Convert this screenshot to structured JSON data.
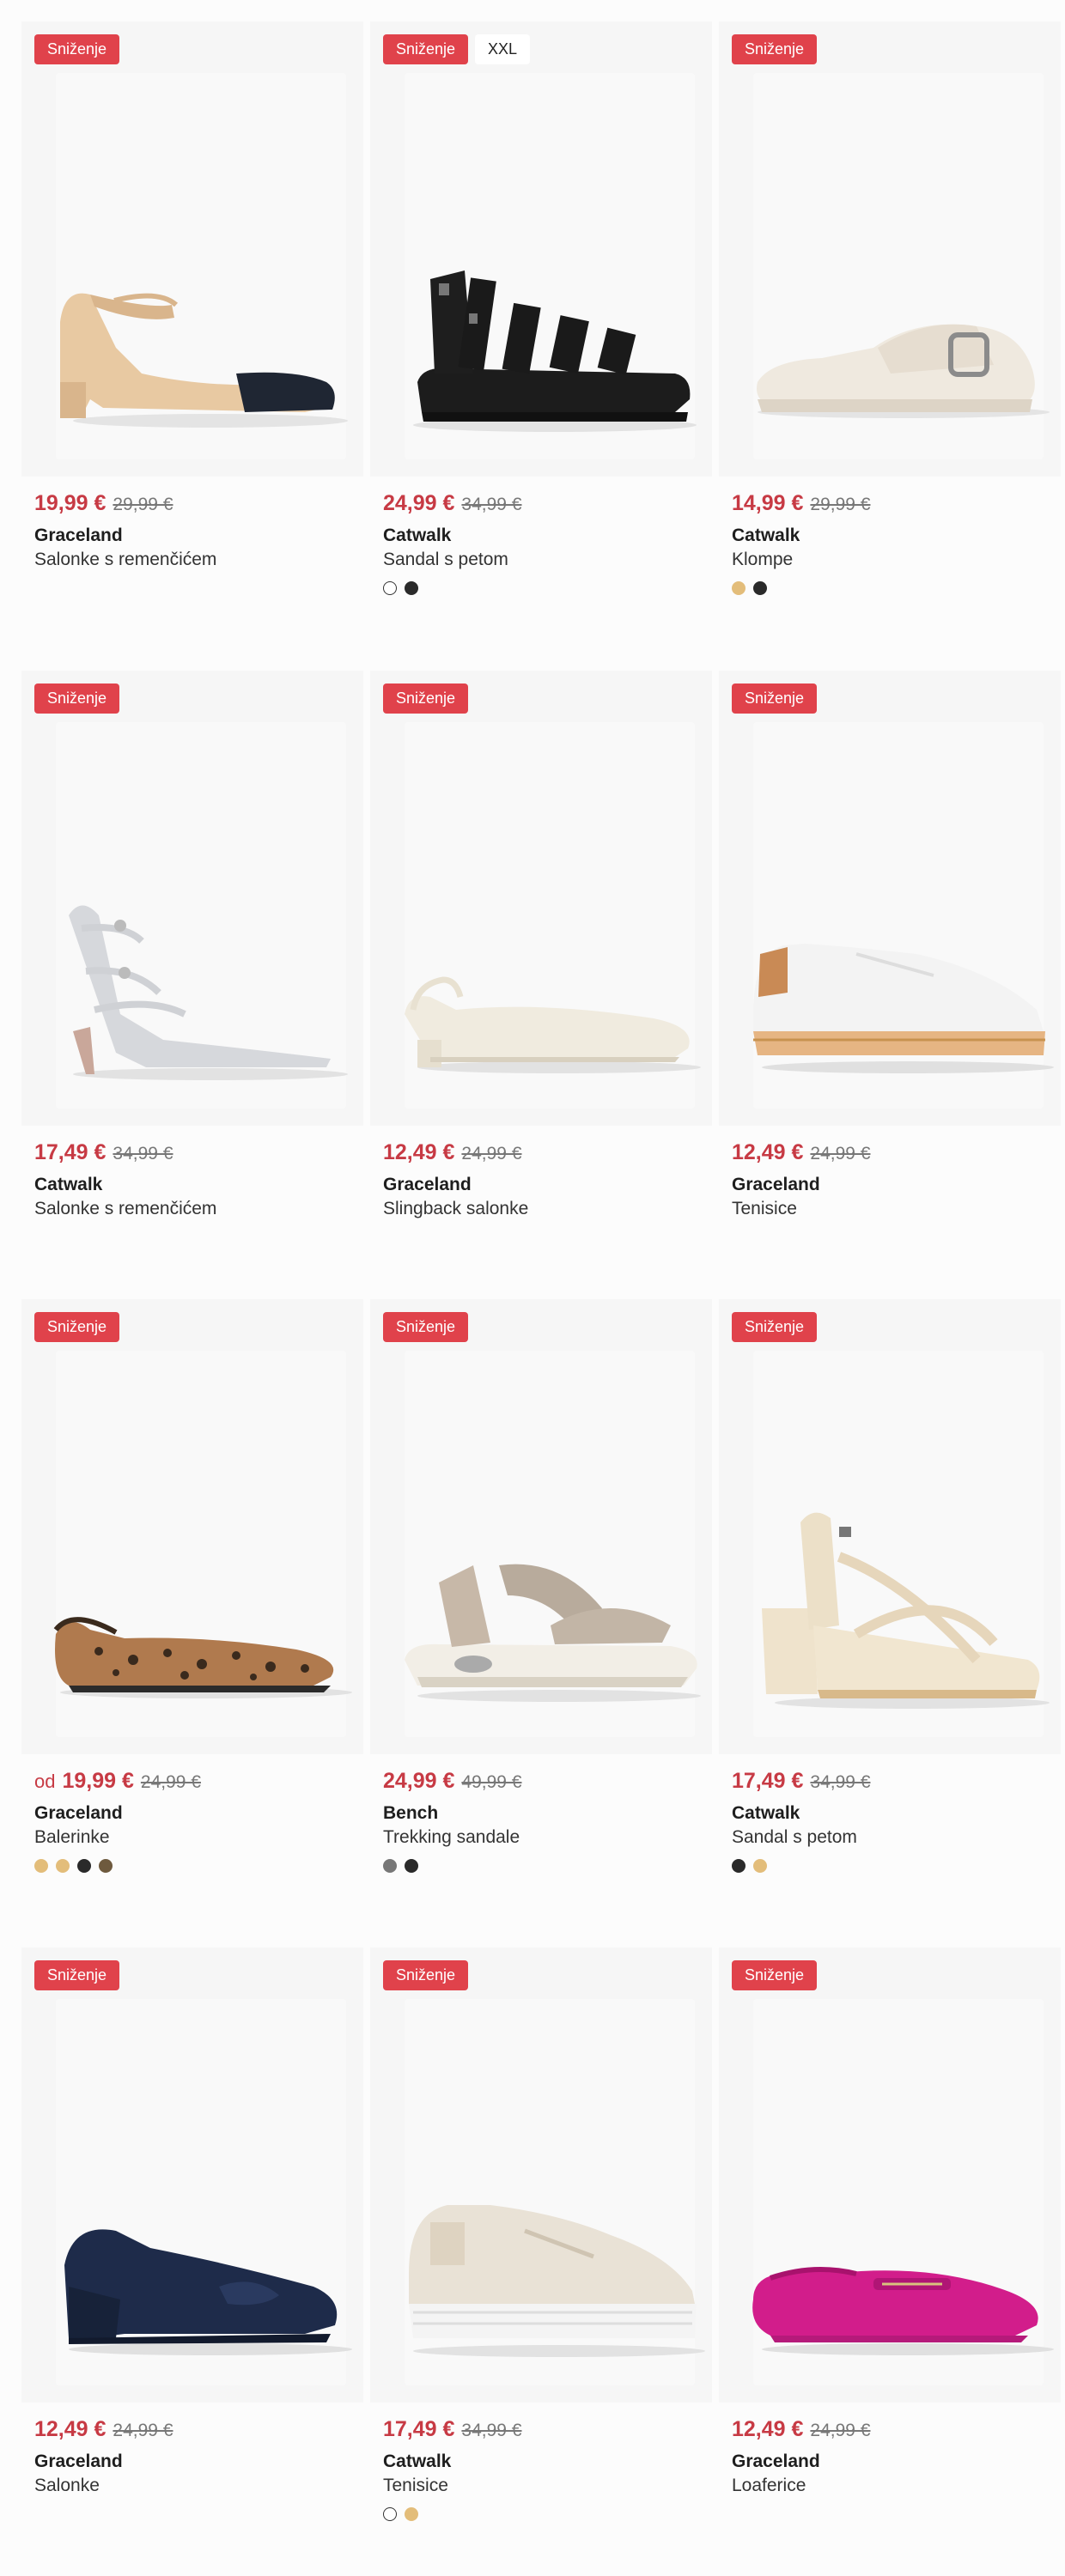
{
  "products": [
    {
      "badge": "Sniženje",
      "size_badge": "",
      "prefix": "",
      "price": "19,99 €",
      "old_price": "29,99 €",
      "brand": "Graceland",
      "name": "Salonke s remenčićem",
      "colors": [],
      "shoe": "beige-pump-strap"
    },
    {
      "badge": "Sniženje",
      "size_badge": "XXL",
      "prefix": "",
      "price": "24,99 €",
      "old_price": "34,99 €",
      "brand": "Catwalk",
      "name": "Sandal s petom",
      "colors": [
        "#ffffff",
        "#2a2a2a"
      ],
      "shoe": "black-gladiator"
    },
    {
      "badge": "Sniženje",
      "size_badge": "",
      "prefix": "",
      "price": "14,99 €",
      "old_price": "29,99 €",
      "brand": "Catwalk",
      "name": "Klompe",
      "colors": [
        "#e3bd7a",
        "#2a2a2a"
      ],
      "shoe": "cream-clog"
    },
    {
      "badge": "Sniženje",
      "size_badge": "",
      "prefix": "",
      "price": "17,49 €",
      "old_price": "34,99 €",
      "brand": "Catwalk",
      "name": "Salonke s remenčićem",
      "colors": [],
      "shoe": "silver-heel"
    },
    {
      "badge": "Sniženje",
      "size_badge": "",
      "prefix": "",
      "price": "12,49 €",
      "old_price": "24,99 €",
      "brand": "Graceland",
      "name": "Slingback salonke",
      "colors": [],
      "shoe": "cream-slingback"
    },
    {
      "badge": "Sniženje",
      "size_badge": "",
      "prefix": "",
      "price": "12,49 €",
      "old_price": "24,99 €",
      "brand": "Graceland",
      "name": "Tenisice",
      "colors": [],
      "shoe": "white-sneaker"
    },
    {
      "badge": "Sniženje",
      "size_badge": "",
      "prefix": "od",
      "price": "19,99 €",
      "old_price": "24,99 €",
      "brand": "Graceland",
      "name": "Balerinke",
      "colors": [
        "#e3bd7a",
        "#e3bd7a",
        "#2a2a2a",
        "#6e5a3e"
      ],
      "shoe": "leopard-flat"
    },
    {
      "badge": "Sniženje",
      "size_badge": "",
      "prefix": "",
      "price": "24,99 €",
      "old_price": "49,99 €",
      "brand": "Bench",
      "name": "Trekking sandale",
      "colors": [
        "#777777",
        "#2a2a2a"
      ],
      "shoe": "trekking-sandal"
    },
    {
      "badge": "Sniženje",
      "size_badge": "",
      "prefix": "",
      "price": "17,49 €",
      "old_price": "34,99 €",
      "brand": "Catwalk",
      "name": "Sandal s petom",
      "colors": [
        "#2a2a2a",
        "#e3bd7a"
      ],
      "shoe": "cream-block-sandal"
    },
    {
      "badge": "Sniženje",
      "size_badge": "",
      "prefix": "",
      "price": "12,49 €",
      "old_price": "24,99 €",
      "brand": "Graceland",
      "name": "Salonke",
      "colors": [],
      "shoe": "navy-wedge"
    },
    {
      "badge": "Sniženje",
      "size_badge": "",
      "prefix": "",
      "price": "17,49 €",
      "old_price": "34,99 €",
      "brand": "Catwalk",
      "name": "Tenisice",
      "colors": [
        "#ffffff",
        "#e3bd7a"
      ],
      "shoe": "platform-sneaker"
    },
    {
      "badge": "Sniženje",
      "size_badge": "",
      "prefix": "",
      "price": "12,49 €",
      "old_price": "24,99 €",
      "brand": "Graceland",
      "name": "Loaferice",
      "colors": [],
      "shoe": "pink-loafer"
    }
  ]
}
